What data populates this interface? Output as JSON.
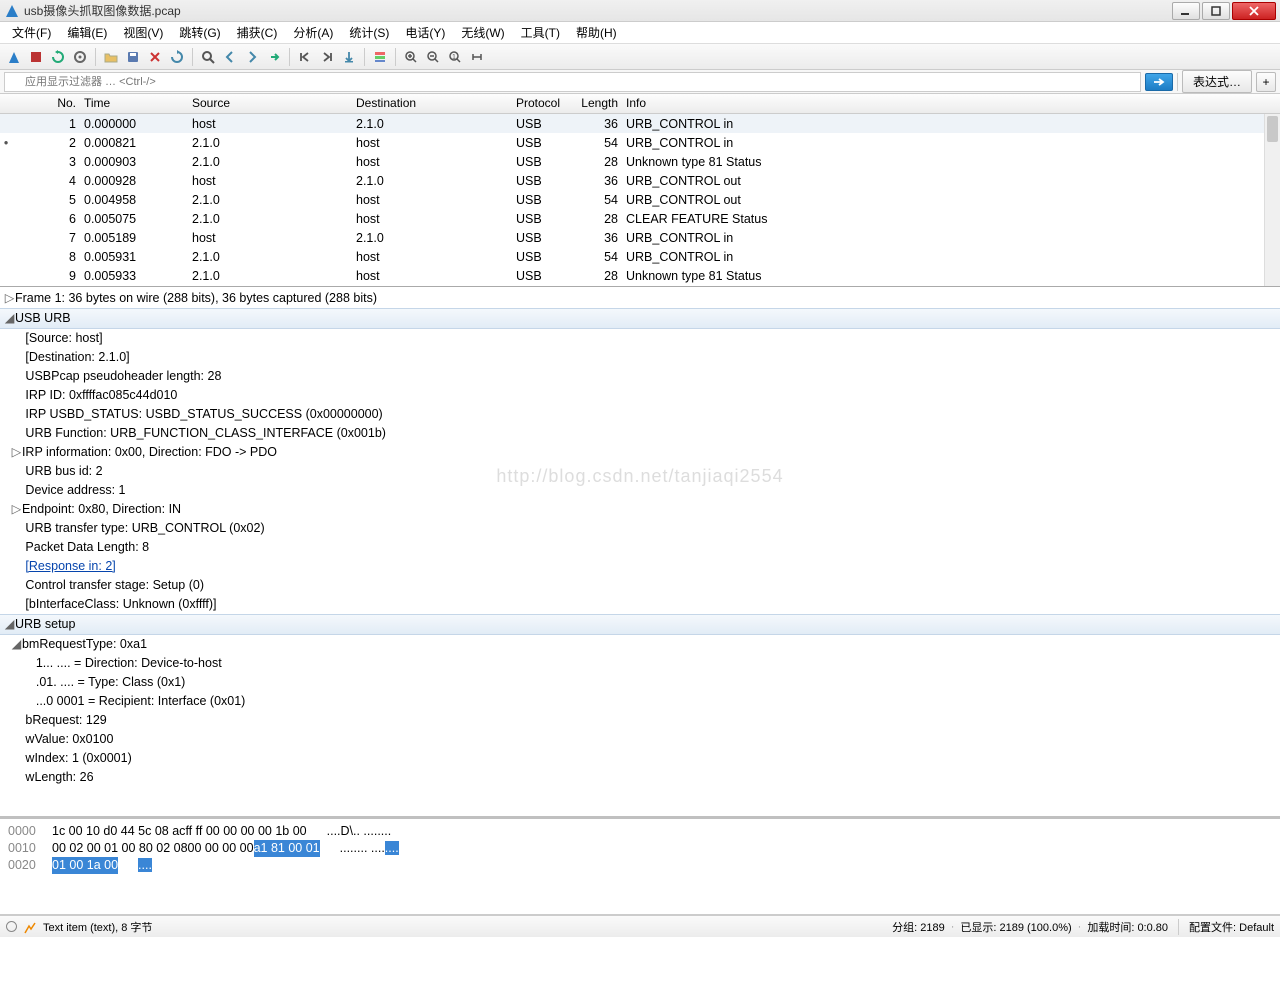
{
  "window": {
    "title": "usb摄像头抓取图像数据.pcap"
  },
  "menu": [
    "文件(F)",
    "编辑(E)",
    "视图(V)",
    "跳转(G)",
    "捕获(C)",
    "分析(A)",
    "统计(S)",
    "电话(Y)",
    "无线(W)",
    "工具(T)",
    "帮助(H)"
  ],
  "filter": {
    "placeholder": "应用显示过滤器 … <Ctrl-/>",
    "expression": "表达式…"
  },
  "columns": {
    "no": "No.",
    "time": "Time",
    "src": "Source",
    "dst": "Destination",
    "proto": "Protocol",
    "len": "Length",
    "info": "Info"
  },
  "packets": [
    {
      "no": 1,
      "time": "0.000000",
      "src": "host",
      "dst": "2.1.0",
      "proto": "USB",
      "len": 36,
      "info": "URB_CONTROL in",
      "sel": true
    },
    {
      "no": 2,
      "time": "0.000821",
      "src": "2.1.0",
      "dst": "host",
      "proto": "USB",
      "len": 54,
      "info": "URB_CONTROL in",
      "mark": true
    },
    {
      "no": 3,
      "time": "0.000903",
      "src": "2.1.0",
      "dst": "host",
      "proto": "USB",
      "len": 28,
      "info": "Unknown type 81 Status"
    },
    {
      "no": 4,
      "time": "0.000928",
      "src": "host",
      "dst": "2.1.0",
      "proto": "USB",
      "len": 36,
      "info": "URB_CONTROL out"
    },
    {
      "no": 5,
      "time": "0.004958",
      "src": "2.1.0",
      "dst": "host",
      "proto": "USB",
      "len": 54,
      "info": "URB_CONTROL out"
    },
    {
      "no": 6,
      "time": "0.005075",
      "src": "2.1.0",
      "dst": "host",
      "proto": "USB",
      "len": 28,
      "info": "CLEAR FEATURE Status"
    },
    {
      "no": 7,
      "time": "0.005189",
      "src": "host",
      "dst": "2.1.0",
      "proto": "USB",
      "len": 36,
      "info": "URB_CONTROL in"
    },
    {
      "no": 8,
      "time": "0.005931",
      "src": "2.1.0",
      "dst": "host",
      "proto": "USB",
      "len": 54,
      "info": "URB_CONTROL in"
    },
    {
      "no": 9,
      "time": "0.005933",
      "src": "2.1.0",
      "dst": "host",
      "proto": "USB",
      "len": 28,
      "info": "Unknown type 81 Status"
    }
  ],
  "details": {
    "frame": "Frame 1: 36 bytes on wire (288 bits), 36 bytes captured (288 bits)",
    "usb_urb": "USB URB",
    "lines1": [
      "[Source: host]",
      "[Destination: 2.1.0]",
      "USBPcap pseudoheader length: 28",
      "IRP ID: 0xffffac085c44d010",
      "IRP USBD_STATUS: USBD_STATUS_SUCCESS (0x00000000)",
      "URB Function: URB_FUNCTION_CLASS_INTERFACE (0x001b)"
    ],
    "irp_info": "IRP information: 0x00, Direction: FDO -> PDO",
    "lines2": [
      "URB bus id: 2",
      "Device address: 1"
    ],
    "endpoint": "Endpoint: 0x80, Direction: IN",
    "lines3": [
      "URB transfer type: URB_CONTROL (0x02)",
      "Packet Data Length: 8"
    ],
    "response": "[Response in: 2]",
    "lines4": [
      "Control transfer stage: Setup (0)",
      "[bInterfaceClass: Unknown (0xffff)]"
    ],
    "urb_setup": "URB setup",
    "bmreq": "bmRequestType: 0xa1",
    "bmreq_bits": [
      "1... .... = Direction: Device-to-host",
      ".01. .... = Type: Class (0x1)",
      "...0 0001 = Recipient: Interface (0x01)"
    ],
    "lines5": [
      "bRequest: 129",
      "wValue: 0x0100",
      "wIndex: 1 (0x0001)",
      "wLength: 26"
    ]
  },
  "watermark": "http://blog.csdn.net/tanjiaqi2554",
  "hex": {
    "rows": [
      {
        "off": "0000",
        "b1": "1c 00 10 d0 44 5c 08 ac",
        "b2": "ff ff 00 00 00 00 1b 00",
        "asc": "....D\\.. ........"
      },
      {
        "off": "0010",
        "b1": "00 02 00 01 00 80 02 08",
        "b2": "00 00 00 00 ",
        "b2s": "a1 81 00 01",
        "asc1": "........ ....",
        "asc1s": "...."
      },
      {
        "off": "0020",
        "b1s": "01 00 1a 00",
        "asc1s": "...."
      }
    ]
  },
  "status": {
    "left": "Text item (text), 8 字节",
    "pkts": "分组: 2189",
    "disp": "已显示: 2189 (100.0%)",
    "load": "加载时间: 0:0.80",
    "profile": "配置文件: Default"
  }
}
